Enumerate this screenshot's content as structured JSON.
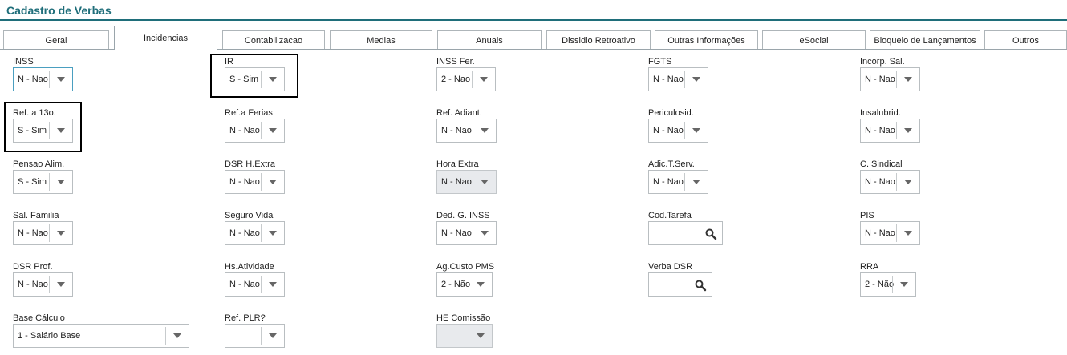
{
  "page_title": "Cadastro de Verbas",
  "tabs": [
    "Geral",
    "Incidencias",
    "Contabilizacao",
    "Medias",
    "Anuais",
    "Dissidio Retroativo",
    "Outras Informações",
    "eSocial",
    "Bloqueio de Lançamentos",
    "Outros"
  ],
  "active_tab": "Incidencias",
  "fields": {
    "inss": {
      "label": "INSS",
      "value": "N - Nao"
    },
    "ir": {
      "label": "IR",
      "value": "S - Sim"
    },
    "inss_fer": {
      "label": "INSS Fer.",
      "value": "2 - Nao"
    },
    "fgts": {
      "label": "FGTS",
      "value": "N - Nao"
    },
    "incorp_sal": {
      "label": "Incorp. Sal.",
      "value": "N - Nao"
    },
    "ref_13o": {
      "label": "Ref. a 13o.",
      "value": "S - Sim"
    },
    "ref_ferias": {
      "label": "Ref.a Ferias",
      "value": "N - Nao"
    },
    "ref_adiant": {
      "label": "Ref. Adiant.",
      "value": "N - Nao"
    },
    "periculosid": {
      "label": "Periculosid.",
      "value": "N - Nao"
    },
    "insalubrid": {
      "label": "Insalubrid.",
      "value": "N - Nao"
    },
    "pensao_alim": {
      "label": "Pensao Alim.",
      "value": "S - Sim"
    },
    "dsr_h_extra": {
      "label": "DSR H.Extra",
      "value": "N - Nao"
    },
    "hora_extra": {
      "label": "Hora Extra",
      "value": "N - Nao"
    },
    "adic_t_serv": {
      "label": "Adic.T.Serv.",
      "value": "N - Nao"
    },
    "c_sindical": {
      "label": "C. Sindical",
      "value": "N - Nao"
    },
    "sal_familia": {
      "label": "Sal. Familia",
      "value": "N - Nao"
    },
    "seguro_vida": {
      "label": "Seguro Vida",
      "value": "N - Nao"
    },
    "ded_g_inss": {
      "label": "Ded. G. INSS",
      "value": "N - Nao"
    },
    "cod_tarefa": {
      "label": "Cod.Tarefa",
      "value": ""
    },
    "pis": {
      "label": "PIS",
      "value": "N - Nao"
    },
    "dsr_prof": {
      "label": "DSR Prof.",
      "value": "N - Nao"
    },
    "hs_atividade": {
      "label": "Hs.Atividade",
      "value": "N - Nao"
    },
    "ag_custo_pms": {
      "label": "Ag.Custo PMS",
      "value": "2 - Não"
    },
    "verba_dsr": {
      "label": "Verba DSR",
      "value": ""
    },
    "rra": {
      "label": "RRA",
      "value": "2 - Não"
    },
    "base_calculo": {
      "label": "Base Cálculo",
      "value": "1 - Salário Base"
    },
    "ref_plr": {
      "label": "Ref. PLR?",
      "value": ""
    },
    "he_comissao": {
      "label": "HE Comissão",
      "value": ""
    }
  },
  "icons": {
    "dropdown": "chevron-down-icon",
    "lookup": "search-icon"
  },
  "colors": {
    "title": "#1f6e7a",
    "focus_border": "#4a9fc0",
    "disabled_bg": "#e8eaed",
    "highlight": "#000000"
  }
}
